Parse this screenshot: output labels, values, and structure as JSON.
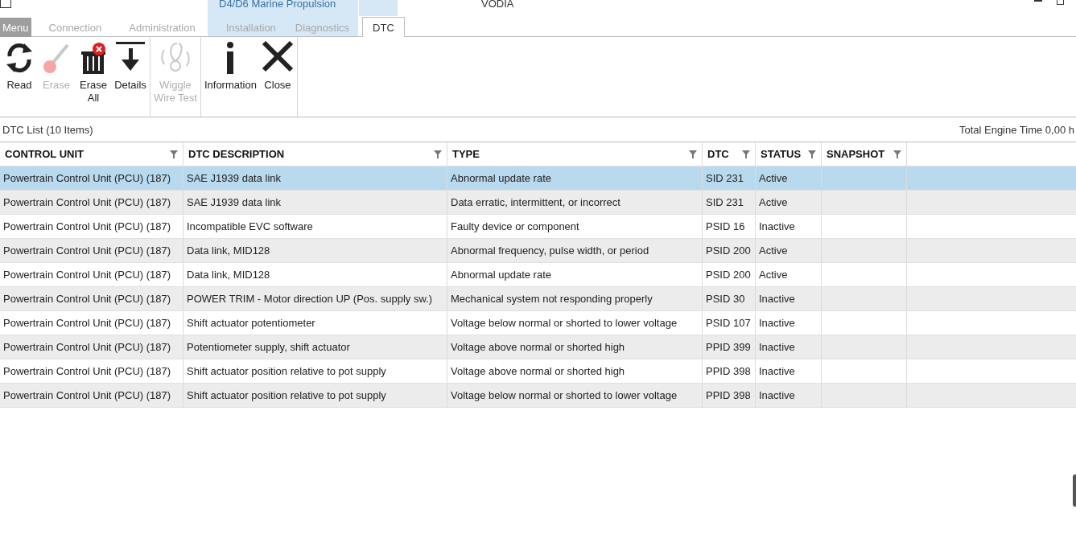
{
  "window": {
    "title": "VODIA",
    "context_group": "D4/D6 Marine Propulsion"
  },
  "tabs": [
    {
      "label": "Menu",
      "kind": "menu",
      "selected": false
    },
    {
      "label": "Connection",
      "kind": "plain",
      "selected": false
    },
    {
      "label": "Administration",
      "kind": "plain",
      "selected": false
    },
    {
      "label": "Installation",
      "kind": "context",
      "selected": false
    },
    {
      "label": "Diagnostics",
      "kind": "context",
      "selected": false
    },
    {
      "label": "DTC",
      "kind": "context",
      "selected": true
    }
  ],
  "ribbon_groups": [
    {
      "buttons": [
        {
          "label": "Read",
          "disabled": false
        },
        {
          "label": "Erase",
          "disabled": true
        },
        {
          "label": "Erase\nAll",
          "disabled": false
        },
        {
          "label": "Details",
          "disabled": false
        }
      ]
    },
    {
      "buttons": [
        {
          "label": "Wiggle\nWire Test",
          "disabled": true
        }
      ]
    },
    {
      "buttons": [
        {
          "label": "Information",
          "disabled": false
        },
        {
          "label": "Close",
          "disabled": false
        }
      ]
    }
  ],
  "list_title": "DTC List (10 Items)",
  "engine_time": "Total Engine Time 0,00 h",
  "table": {
    "columns": [
      "CONTROL UNIT",
      "DTC DESCRIPTION",
      "TYPE",
      "DTC",
      "STATUS",
      "SNAPSHOT"
    ],
    "rows": [
      {
        "selected": true,
        "cells": [
          "Powertrain Control Unit (PCU) (187)",
          "SAE J1939 data link",
          "Abnormal update rate",
          "SID 231",
          "Active"
        ]
      },
      {
        "selected": false,
        "cells": [
          "Powertrain Control Unit (PCU) (187)",
          "SAE J1939 data link",
          "Data erratic, intermittent, or incorrect",
          "SID 231",
          "Active"
        ]
      },
      {
        "selected": false,
        "cells": [
          "Powertrain Control Unit (PCU) (187)",
          "Incompatible EVC software",
          "Faulty device or component",
          "PSID 16",
          "Inactive"
        ]
      },
      {
        "selected": false,
        "cells": [
          "Powertrain Control Unit (PCU) (187)",
          "Data link, MID128",
          "Abnormal frequency, pulse width, or period",
          "PSID 200",
          "Active"
        ]
      },
      {
        "selected": false,
        "cells": [
          "Powertrain Control Unit (PCU) (187)",
          "Data link, MID128",
          "Abnormal update rate",
          "PSID 200",
          "Active"
        ]
      },
      {
        "selected": false,
        "cells": [
          "Powertrain Control Unit (PCU) (187)",
          "POWER TRIM - Motor direction UP (Pos. supply sw.)",
          "Mechanical system not responding properly",
          "PSID 30",
          "Inactive"
        ]
      },
      {
        "selected": false,
        "cells": [
          "Powertrain Control Unit (PCU) (187)",
          "Shift actuator potentiometer",
          "Voltage below normal or shorted to lower voltage",
          "PSID 107",
          "Inactive"
        ]
      },
      {
        "selected": false,
        "cells": [
          "Powertrain Control Unit (PCU) (187)",
          "Potentiometer supply, shift actuator",
          "Voltage above normal or shorted high",
          "PPID 399",
          "Inactive"
        ]
      },
      {
        "selected": false,
        "cells": [
          "Powertrain Control Unit (PCU) (187)",
          "Shift actuator position relative to pot supply",
          "Voltage above normal or shorted high",
          "PPID 398",
          "Inactive"
        ]
      },
      {
        "selected": false,
        "cells": [
          "Powertrain Control Unit (PCU) (187)",
          "Shift actuator position relative to pot supply",
          "Voltage below normal or shorted to lower voltage",
          "PPID 398",
          "Inactive"
        ]
      }
    ]
  }
}
